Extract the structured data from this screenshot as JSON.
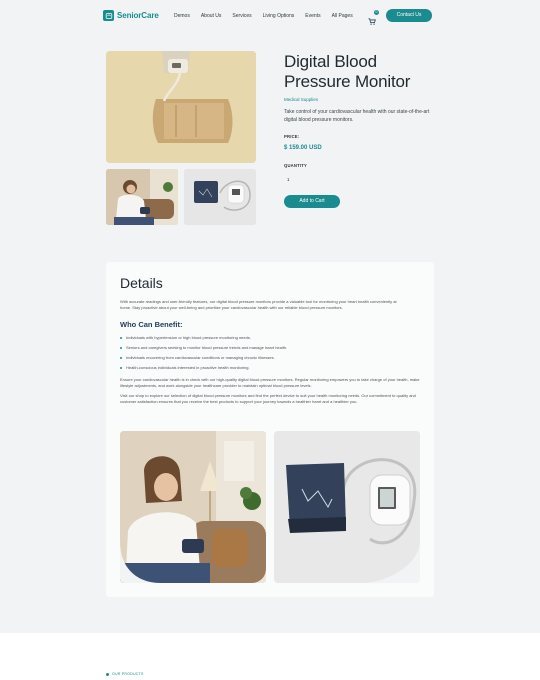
{
  "nav": {
    "logo_text": "SeniorCare",
    "menu": [
      "Demos",
      "About Us",
      "Services",
      "Living Options",
      "Events",
      "All Pages"
    ],
    "cart_count": "0",
    "contact_label": "Contact Us"
  },
  "product": {
    "title": "Digital Blood Pressure Monitor",
    "category": "Medical Supplies",
    "description": "Take control of your cardiovascular health with our state-of-the-art digital blood pressure monitors.",
    "price_label": "PRICE:",
    "price": "$ 159.00 USD",
    "quantity_label": "QUANTITY",
    "quantity_value": "1",
    "add_to_cart_label": "Add to Cart"
  },
  "details": {
    "title": "Details",
    "intro": "With accurate readings and user-friendly features, our digital blood pressure monitors provide a valuable tool for monitoring your heart health conveniently at home. Stay proactive about your well-being and prioritize your cardiovascular health with our reliable blood pressure monitors.",
    "benefit_heading": "Who Can Benefit:",
    "benefits": [
      "Individuals with hypertension or high blood pressure monitoring needs.",
      "Seniors and caregivers seeking to monitor blood pressure trends and manage heart health.",
      "Individuals recovering from cardiovascular conditions or managing chronic illnesses.",
      "Health-conscious individuals interested in proactive health monitoring."
    ],
    "para1": "Ensure your cardiovascular health is in check with our high-quality digital blood pressure monitors. Regular monitoring empowers you to take charge of your health, make lifestyle adjustments, and work alongside your healthcare provider to maintain optimal blood pressure levels.",
    "para2": "Visit our shop to explore our selection of digital blood pressure monitors and find the perfect device to suit your health monitoring needs. Our commitment to quality and customer satisfaction ensures that you receive the best products to support your journey towards a healthier heart and a healthier you."
  },
  "bottom": {
    "section_label": "OUR PRODUCTS"
  },
  "colors": {
    "accent": "#1a8c8f",
    "background": "#f1f3f5"
  }
}
